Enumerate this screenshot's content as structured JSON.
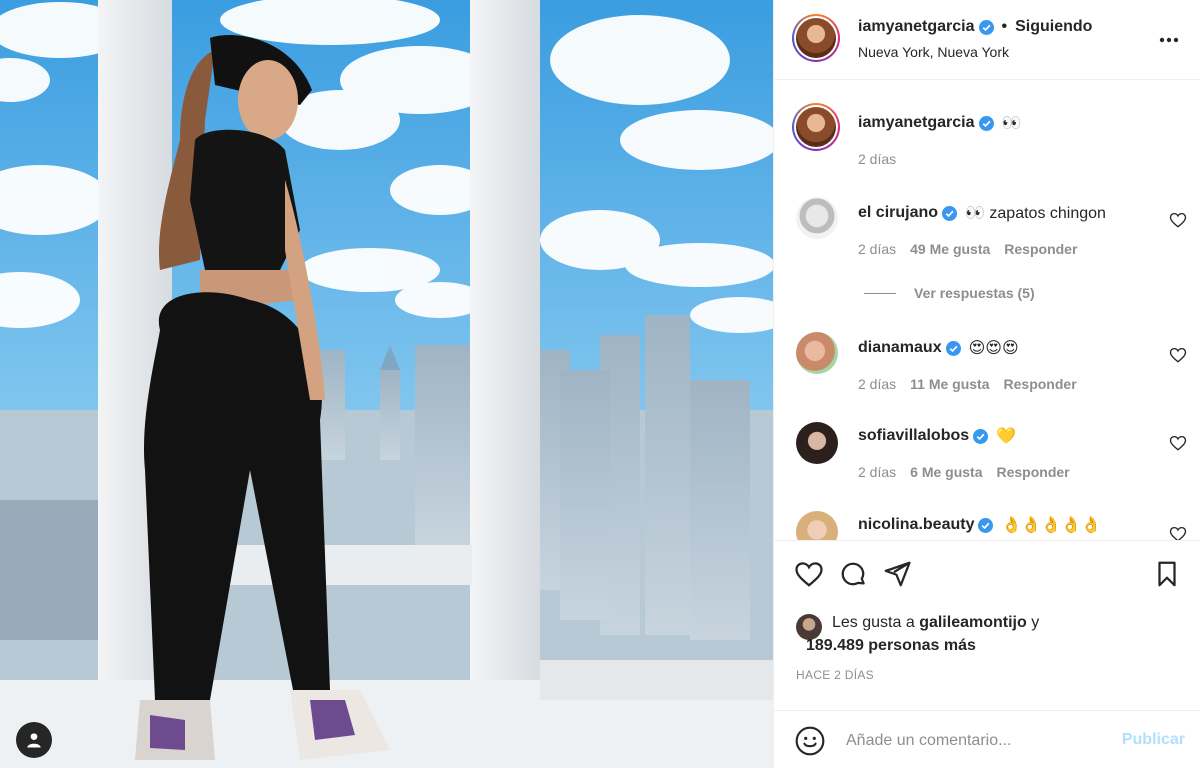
{
  "post": {
    "author": "iamyanetgarcia",
    "follow_state": "Siguiendo",
    "separator": "•",
    "location": "Nueva York, Nueva York"
  },
  "caption": {
    "username": "iamyanetgarcia",
    "text": "👀",
    "time": "2 días"
  },
  "comments": [
    {
      "username": "el cirujano",
      "text": "👀 zapatos chingon",
      "time": "2 días",
      "likes": "49 Me gusta",
      "reply": "Responder"
    },
    {
      "username": "dianamaux",
      "text": "😍😍😍",
      "time": "2 días",
      "likes": "11 Me gusta",
      "reply": "Responder"
    },
    {
      "username": "sofiavillalobos",
      "text": "💛",
      "time": "2 días",
      "likes": "6 Me gusta",
      "reply": "Responder"
    },
    {
      "username": "nicolina.beauty",
      "text": "👌👌👌👌👌"
    }
  ],
  "view_replies": "Ver respuestas (5)",
  "likes": {
    "prefix": "Les gusta a",
    "liker": "galileamontijo",
    "conj": "y",
    "others": "189.489 personas más"
  },
  "timestamp": "HACE 2 DÍAS",
  "composer": {
    "placeholder": "Añade un comentario...",
    "publish": "Publicar"
  },
  "icons": {
    "verified": "verified-badge-icon",
    "more": "more-options-icon",
    "like": "heart-icon",
    "comment": "comment-bubble-icon",
    "share": "paper-plane-icon",
    "save": "bookmark-icon",
    "emoji": "smiley-icon",
    "tag": "person-tag-icon"
  },
  "colors": {
    "verified": "#3897f0",
    "publish_disabled": "#b2dffc",
    "meta_text": "#8e8e8e"
  }
}
